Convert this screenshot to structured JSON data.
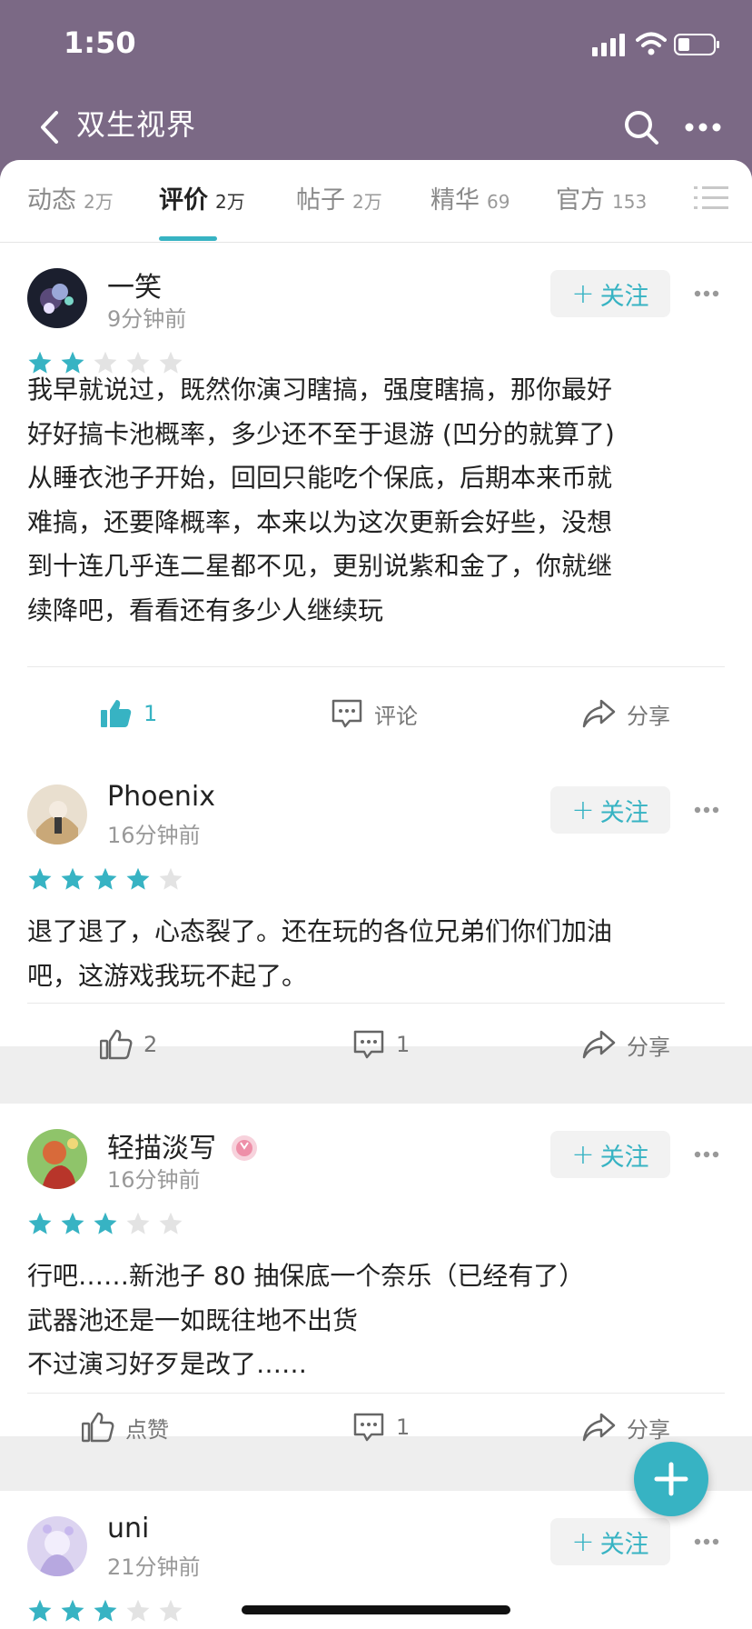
{
  "status_bar": {
    "time": "1:50"
  },
  "header": {
    "title": "双生视界"
  },
  "tabs": [
    {
      "label": "动态",
      "count": "2万"
    },
    {
      "label": "评价",
      "count": "2万",
      "active": true
    },
    {
      "label": "帖子",
      "count": "2万"
    },
    {
      "label": "精华",
      "count": "69"
    },
    {
      "label": "官方",
      "count": "153"
    }
  ],
  "follow_label": "关注",
  "reviews": [
    {
      "username": "一笑",
      "time": "9分钟前",
      "rating": 2,
      "text": "我早就说过，既然你演习瞎搞，强度瞎搞，那你最好\n好好搞卡池概率，多少还不至于退游 (凹分的就算了)\n从睡衣池子开始，回回只能吃个保底，后期本来币就\n难搞，还要降概率，本来以为这次更新会好些，没想\n到十连几乎连二星都不见，更别说紫和金了，你就继\n续降吧，看看还有多少人继续玩",
      "like_label": "1",
      "comment_label": "评论",
      "share_label": "分享"
    },
    {
      "username": "Phoenix",
      "time": "16分钟前",
      "rating": 4,
      "text": "退了退了，心态裂了。还在玩的各位兄弟们你们加油\n吧，这游戏我玩不起了。",
      "like_label": "2",
      "comment_label": "1",
      "share_label": "分享"
    },
    {
      "username": "轻描淡写",
      "time": "16分钟前",
      "rating": 3,
      "text": "行吧……新池子 80 抽保底一个奈乐（已经有了）\n武器池还是一如既往地不出货\n不过演习好歹是改了……",
      "like_label": "点赞",
      "comment_label": "1",
      "share_label": "分享"
    },
    {
      "username": "uni",
      "time": "21分钟前",
      "rating": 3
    }
  ],
  "colors": {
    "accent": "#37b3c3",
    "header_bg": "#7b6985",
    "star_empty": "#e3e3e3"
  },
  "icons": [
    "back-icon",
    "search-icon",
    "more-icon",
    "list-icon",
    "thumbs-up-icon",
    "comment-icon",
    "share-icon",
    "plus-icon"
  ]
}
